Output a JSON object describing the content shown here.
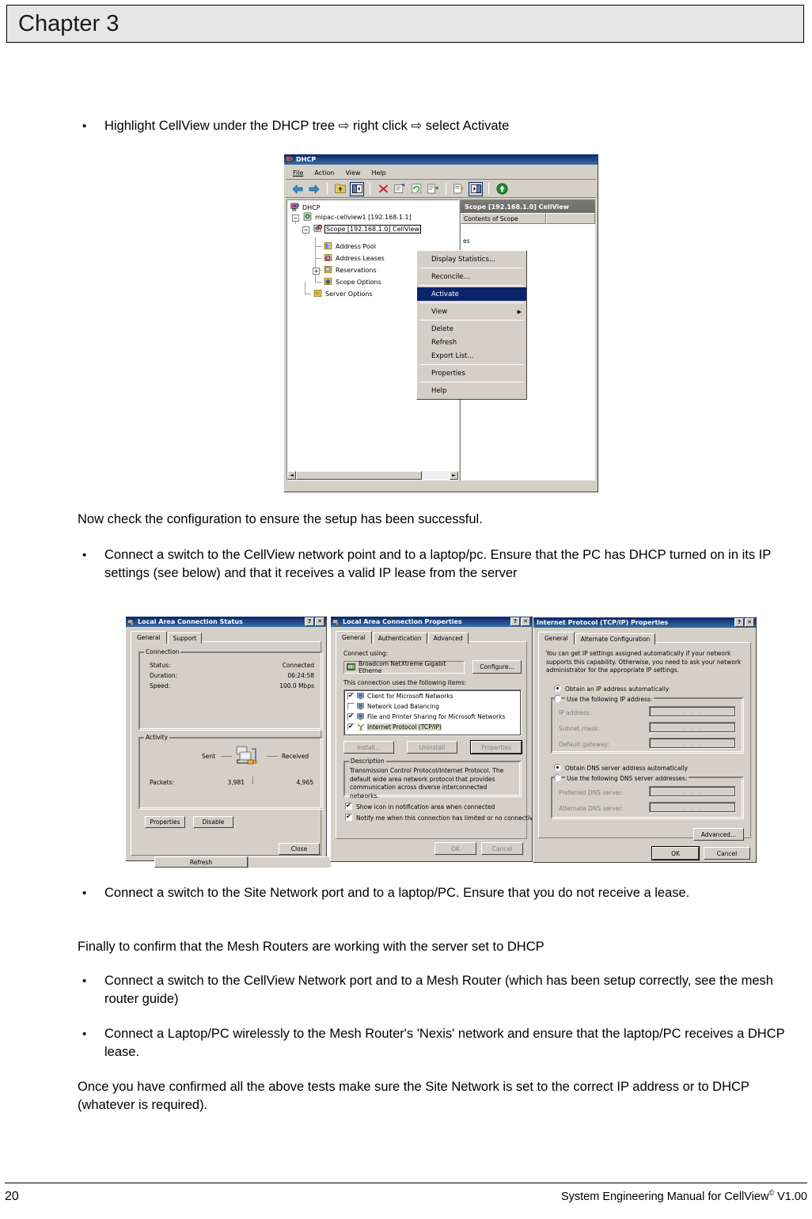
{
  "chapter": {
    "title": "Chapter 3"
  },
  "footer": {
    "page_number": "20",
    "manual_text": "System Engineering Manual for CellView",
    "copyright": "©",
    "version": " V1.00"
  },
  "body": {
    "bullet1": "Highlight CellView under the DHCP tree ⇨ right click ⇨ select Activate",
    "para1": "Now check the configuration to ensure the setup has been successful.",
    "bullet2": "Connect a switch to the CellView network point and to a laptop/pc. Ensure that the PC has DHCP turned on in its IP settings (see below) and that it receives a valid IP lease from the server",
    "bullet3": "Connect a switch to the Site Network port and to a laptop/PC. Ensure that you do not receive a lease.",
    "para2": "Finally to confirm that the Mesh Routers are working with the server set to DHCP",
    "bullet4": "Connect a switch to the CellView Network port and to a Mesh Router (which has been setup correctly, see the mesh router guide)",
    "bullet5": "Connect a Laptop/PC wirelessly to the Mesh Router's 'Nexis' network and ensure that the laptop/PC receives a DHCP lease.",
    "para3": "Once you have confirmed all the above tests make sure the Site Network is set to the correct IP address or to DHCP (whatever is required).",
    "bullet_glyph": "•"
  },
  "dhcp_window": {
    "title": "DHCP",
    "menus": [
      "File",
      "Action",
      "View",
      "Help"
    ],
    "toolbar_icons": [
      "back-arrow-icon",
      "forward-arrow-icon",
      "up-folder-icon",
      "show-tree-icon",
      "delete-icon",
      "properties-icon",
      "refresh-icon",
      "export-list-icon",
      "help-icon",
      "show-pane-icon",
      "activate-icon"
    ],
    "tree": {
      "root": "DHCP",
      "server": "mipac-cellview1 [192.168.1.1]",
      "scope": "Scope [192.168.1.0] CellView",
      "children": [
        "Address Pool",
        "Address Leases",
        "Reservations",
        "Scope Options"
      ],
      "server_options": "Server Options"
    },
    "right_pane": {
      "header": "Scope [192.168.1.0] CellView",
      "column1": "Contents of Scope",
      "column2": "",
      "partial_row1": "es",
      "partial_row2": "s"
    },
    "context_menu": [
      {
        "label": "Display Statistics...",
        "selected": false,
        "submenu": false
      },
      {
        "separator": true
      },
      {
        "label": "Reconcile...",
        "selected": false,
        "submenu": false
      },
      {
        "separator": true
      },
      {
        "label": "Activate",
        "selected": true,
        "submenu": false
      },
      {
        "separator": true
      },
      {
        "label": "View",
        "selected": false,
        "submenu": true
      },
      {
        "separator": true
      },
      {
        "label": "Delete",
        "selected": false,
        "submenu": false
      },
      {
        "label": "Refresh",
        "selected": false,
        "submenu": false
      },
      {
        "label": "Export List...",
        "selected": false,
        "submenu": false
      },
      {
        "separator": true
      },
      {
        "label": "Properties",
        "selected": false,
        "submenu": false
      },
      {
        "separator": true
      },
      {
        "label": "Help",
        "selected": false,
        "submenu": false
      }
    ]
  },
  "lac_status": {
    "title": "Local Area Connection Status",
    "tabs": [
      "General",
      "Support"
    ],
    "connection_group": "Connection",
    "rows": [
      {
        "label": "Status:",
        "value": "Connected"
      },
      {
        "label": "Duration:",
        "value": "06:24:58"
      },
      {
        "label": "Speed:",
        "value": "100.0 Mbps"
      }
    ],
    "activity_group": "Activity",
    "sent_label": "Sent",
    "received_label": "Received",
    "packets_label": "Packets:",
    "packets_sent": "3,981",
    "packets_received": "4,965",
    "buttons": {
      "properties": "Properties",
      "disable": "Disable",
      "close": "Close"
    },
    "behind_button": "Refresh"
  },
  "lac_properties": {
    "title": "Local Area Connection Properties",
    "tabs": [
      "General",
      "Authentication",
      "Advanced"
    ],
    "connect_using_label": "Connect using:",
    "adapter": "Broadcom NetXtreme Gigabit Etherne",
    "configure_button": "Configure...",
    "items_label": "This connection uses the following items:",
    "items": [
      {
        "label": "Client for Microsoft Networks",
        "checked": true,
        "selected": false
      },
      {
        "label": "Network Load Balancing",
        "checked": false,
        "selected": false
      },
      {
        "label": "File and Printer Sharing for Microsoft Networks",
        "checked": true,
        "selected": false
      },
      {
        "label": "Internet Protocol (TCP/IP)",
        "checked": true,
        "selected": true
      }
    ],
    "buttons": {
      "install": "Install...",
      "uninstall": "Uninstall",
      "properties": "Properties",
      "ok": "OK",
      "cancel": "Cancel"
    },
    "description_group": "Description",
    "description": "Transmission Control Protocol/Internet Protocol. The default wide area network protocol that provides communication across diverse interconnected networks.",
    "checkboxes": [
      {
        "label": "Show icon in notification area when connected",
        "checked": true
      },
      {
        "label": "Notify me when this connection has limited or no connectivity",
        "checked": true
      }
    ]
  },
  "tcpip_properties": {
    "title": "Internet Protocol (TCP/IP) Properties",
    "tabs": [
      "General",
      "Alternate Configuration"
    ],
    "intro": "You can get IP settings assigned automatically if your network supports this capability. Otherwise, you need to ask your network administrator for the appropriate IP settings.",
    "radio_auto_ip": {
      "label": "Obtain an IP address automatically",
      "selected": true
    },
    "radio_manual_ip": {
      "label": "Use the following IP address:",
      "selected": false
    },
    "ip_fields": [
      {
        "label": "IP address:",
        "value": ""
      },
      {
        "label": "Subnet mask:",
        "value": ""
      },
      {
        "label": "Default gateway:",
        "value": ""
      }
    ],
    "radio_auto_dns": {
      "label": "Obtain DNS server address automatically",
      "selected": true
    },
    "radio_manual_dns": {
      "label": "Use the following DNS server addresses:",
      "selected": false
    },
    "dns_fields": [
      {
        "label": "Preferred DNS server:",
        "value": ""
      },
      {
        "label": "Alternate DNS server:",
        "value": ""
      }
    ],
    "buttons": {
      "advanced": "Advanced...",
      "ok": "OK",
      "cancel": "Cancel"
    }
  },
  "colors": {
    "dialog_face": "#d4d0c8",
    "titlebar_start": "#0a246a",
    "titlebar_end": "#3a6ea5",
    "menu_highlight": "#0a246a",
    "header_bg": "#e6e6e6"
  }
}
